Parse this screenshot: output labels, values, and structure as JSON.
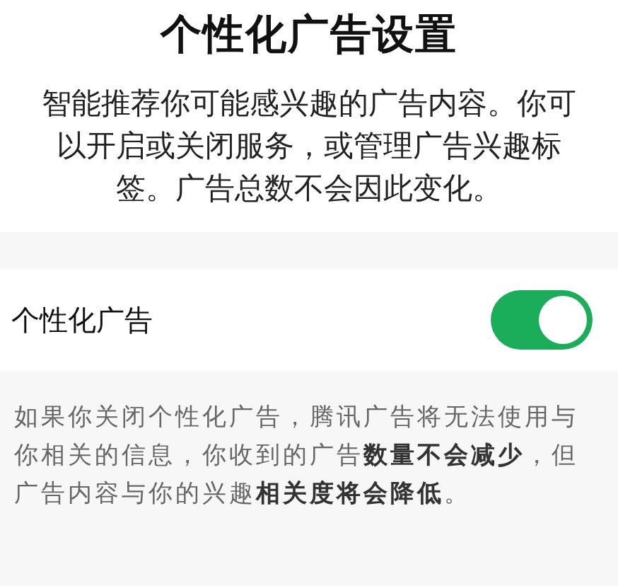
{
  "title": "个性化广告设置",
  "description": "智能推荐你可能感兴趣的广告内容。你可以开启或关闭服务，或管理广告兴趣标签。广告总数不会因此变化。",
  "setting": {
    "label": "个性化广告",
    "on": true
  },
  "note": "如果你关闭个性化广告，腾讯广告将无法使用与你相关的信息，你收到的广告**数量不会减少**，但广告内容与你的兴趣**相关度将会降低**。"
}
